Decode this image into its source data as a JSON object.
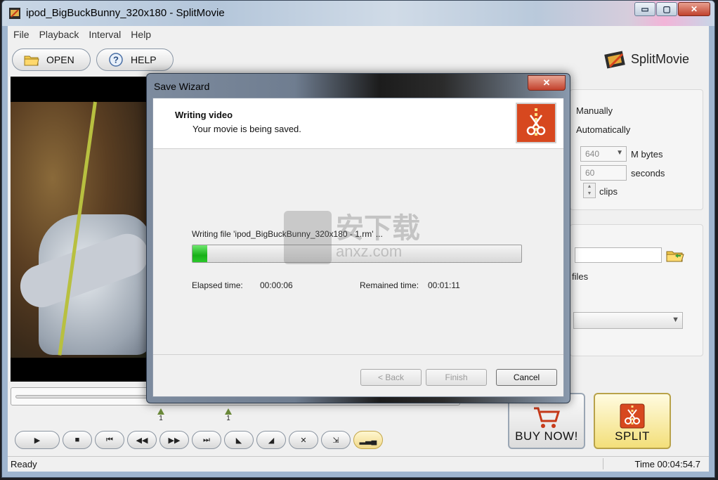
{
  "window": {
    "title": "ipod_BigBuckBunny_320x180 - SplitMovie",
    "minimize": "▭",
    "maximize": "▢",
    "close": "✕"
  },
  "menu": {
    "items": [
      "File",
      "Playback",
      "Interval",
      "Help"
    ]
  },
  "toolbar": {
    "open_label": "OPEN",
    "help_label": "HELP",
    "brand_name": "SplitMovie"
  },
  "settings": {
    "manually_label": "Manually",
    "automatically_label": "Automatically",
    "size_value": "640",
    "size_unit": "M bytes",
    "duration_value": "60",
    "duration_unit": "seconds",
    "clips_unit": "clips",
    "files_label": "files"
  },
  "markers": [
    "1",
    "1"
  ],
  "buttons": {
    "buy_label": "BUY NOW!",
    "split_label": "SPLIT"
  },
  "status": {
    "left": "Ready",
    "right": "Time 00:04:54.7"
  },
  "dialog": {
    "title": "Save Wizard",
    "close": "✕",
    "heading": "Writing video",
    "subheading": "Your movie is being saved.",
    "writing_file": "Writing file 'ipod_BigBuckBunny_320x180 - 1.rm' ...",
    "progress_fraction": 0.045,
    "elapsed_label": "Elapsed time:",
    "elapsed_value": "00:00:06",
    "remaining_label": "Remained time:",
    "remaining_value": "00:01:11",
    "back_label": "< Back",
    "finish_label": "Finish",
    "cancel_label": "Cancel"
  },
  "watermark": {
    "text": "安下载",
    "sub": "anxz.com"
  },
  "colors": {
    "progress": "#18b018",
    "split_button": "#f3df7a",
    "accent_close": "#c2412c"
  }
}
